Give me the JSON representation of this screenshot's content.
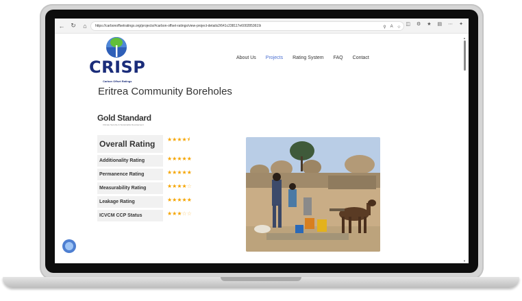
{
  "browser": {
    "url": "https://carbonoffsetratings.org/projects/#carbon-offset-ratings/view-project-details2/641c238117e6002853619/"
  },
  "brand": {
    "name": "CRISP",
    "tagline": "Carbon Offset Ratings"
  },
  "nav": {
    "items": [
      {
        "label": "About Us",
        "active": false
      },
      {
        "label": "Projects",
        "active": true
      },
      {
        "label": "Rating System",
        "active": false
      },
      {
        "label": "FAQ",
        "active": false
      },
      {
        "label": "Contact",
        "active": false
      }
    ]
  },
  "project": {
    "title": "Eritrea Community Boreholes",
    "standard": "Gold Standard",
    "standard_tagline": "Climate Security & Sustainable Development"
  },
  "ratings": [
    {
      "label": "Overall Rating",
      "stars": 4.5
    },
    {
      "label": "Additionality Rating",
      "stars": 5
    },
    {
      "label": "Permanence Rating",
      "stars": 5
    },
    {
      "label": "Measurability Rating",
      "stars": 4
    },
    {
      "label": "Leakage Rating",
      "stars": 5
    },
    {
      "label": "ICVCM CCP Status",
      "stars": 3
    }
  ],
  "colors": {
    "brand_blue": "#1b2d7a",
    "accent_link": "#4a6fd1",
    "star": "#f5a400"
  },
  "icons": {
    "chat": "chat-bubble-icon"
  }
}
